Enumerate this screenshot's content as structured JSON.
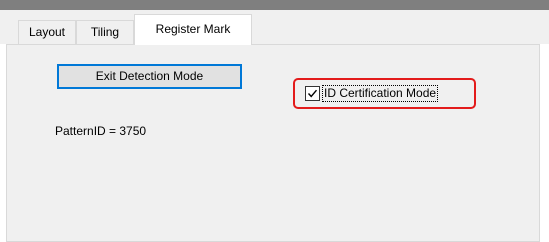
{
  "tabs": [
    {
      "label": "Layout",
      "active": false
    },
    {
      "label": "Tiling",
      "active": false
    },
    {
      "label": "Register Mark",
      "active": true
    }
  ],
  "panel": {
    "exit_button_label": "Exit Detection Mode",
    "id_certification": {
      "label": "ID Certification Mode",
      "checked": true
    },
    "pattern_id_text": "PatternID = 3750"
  },
  "colors": {
    "accent_focus": "#0078d7",
    "highlight": "#e31b1b",
    "panel_bg": "#f0f0f0"
  }
}
